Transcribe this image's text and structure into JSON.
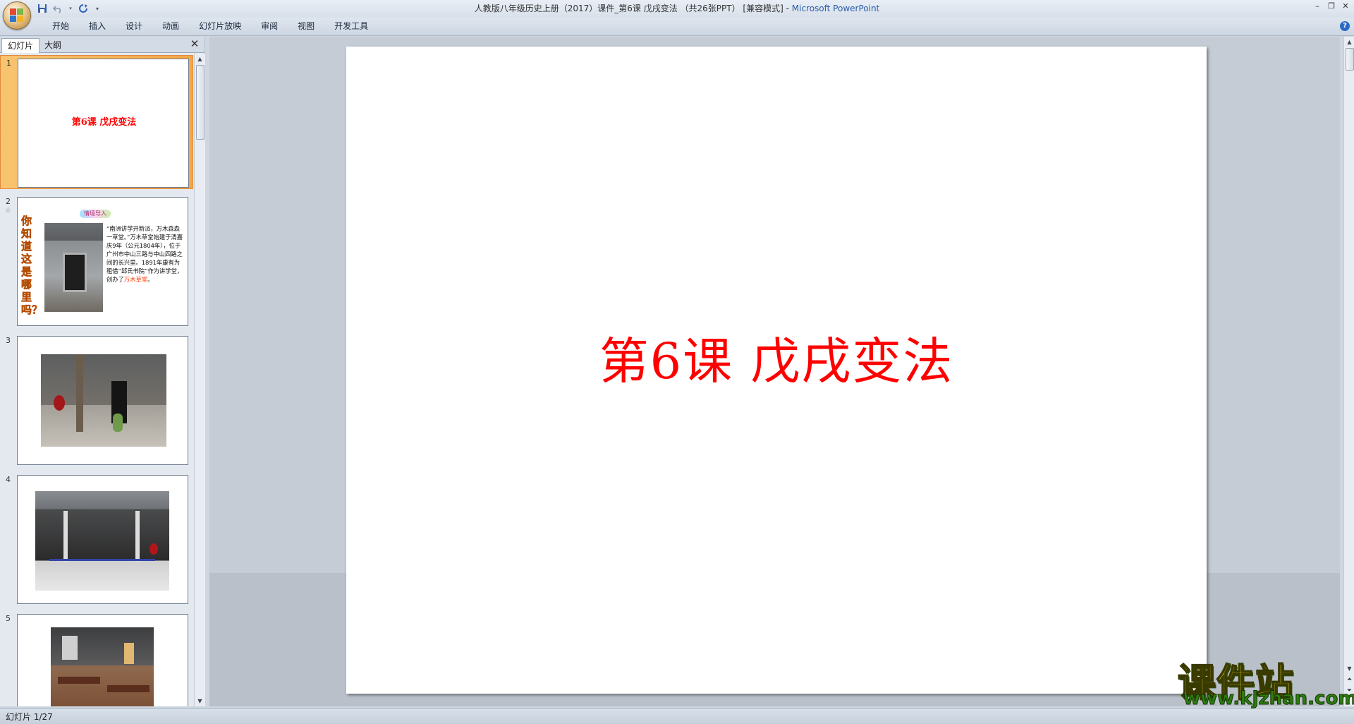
{
  "window": {
    "title_doc": "人教版八年级历史上册（2017）课件_第6课 戊戌变法 （共26张PPT） [兼容模式] - ",
    "title_app": "Microsoft PowerPoint"
  },
  "ribbon": {
    "tabs": [
      "开始",
      "插入",
      "设计",
      "动画",
      "幻灯片放映",
      "审阅",
      "视图",
      "开发工具"
    ]
  },
  "panel": {
    "tab_slides": "幻灯片",
    "tab_outline": "大纲",
    "slides": [
      {
        "num": "1",
        "title": "第6课  戊戌变法"
      },
      {
        "num": "2",
        "star": "☆",
        "side_text": "你知道这是哪里吗？",
        "badge": "情境导入",
        "body": "“南洲讲学开新派，万木森森一草堂。”万木草堂始建于清嘉庆9年（公元1804年），位于广州市中山三路与中山四路之间的长兴里。1891年康有为租借“邱氏书院”作为讲学堂，创办了",
        "body_highlight": "万木草堂",
        "body_end": "。"
      },
      {
        "num": "3"
      },
      {
        "num": "4"
      },
      {
        "num": "5"
      }
    ]
  },
  "slide": {
    "title": "第6课  戊戌变法"
  },
  "status": {
    "slide_counter": "幻灯片 1/27"
  },
  "watermark": {
    "name": "课件站",
    "url": "www.kjzhan.com"
  }
}
